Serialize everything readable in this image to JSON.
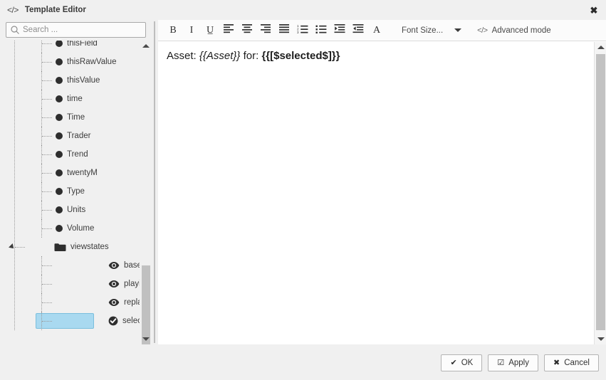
{
  "window": {
    "title": "Template Editor",
    "code_icon": "</>",
    "close_icon": "✖"
  },
  "sidebar": {
    "search": {
      "placeholder": "Search ...",
      "value": "",
      "icon": "search-icon"
    },
    "tree": [
      {
        "label": "thisField",
        "icon": "bullet-dot-icon",
        "level": 2,
        "selected": false
      },
      {
        "label": "thisRawValue",
        "icon": "bullet-dot-icon",
        "level": 2,
        "selected": false
      },
      {
        "label": "thisValue",
        "icon": "bullet-dot-icon",
        "level": 2,
        "selected": false
      },
      {
        "label": "time",
        "icon": "bullet-dot-icon",
        "level": 2,
        "selected": false
      },
      {
        "label": "Time",
        "icon": "bullet-dot-icon",
        "level": 2,
        "selected": false
      },
      {
        "label": "Trader",
        "icon": "bullet-dot-icon",
        "level": 2,
        "selected": false
      },
      {
        "label": "Trend",
        "icon": "bullet-dot-icon",
        "level": 2,
        "selected": false
      },
      {
        "label": "twentyM",
        "icon": "bullet-dot-icon",
        "level": 2,
        "selected": false
      },
      {
        "label": "Type",
        "icon": "bullet-dot-icon",
        "level": 2,
        "selected": false
      },
      {
        "label": "Units",
        "icon": "bullet-dot-icon",
        "level": 2,
        "selected": false
      },
      {
        "label": "Volume",
        "icon": "bullet-dot-icon",
        "level": 2,
        "selected": false
      },
      {
        "label": "viewstates",
        "icon": "folder-icon",
        "level": 1,
        "selected": false,
        "expanded": true
      },
      {
        "label": "basetime",
        "icon": "eye-icon",
        "level": 2,
        "selected": false
      },
      {
        "label": "playing",
        "icon": "eye-icon",
        "level": 2,
        "selected": false
      },
      {
        "label": "replayValue",
        "icon": "eye-icon",
        "level": 2,
        "selected": false
      },
      {
        "label": "selected",
        "icon": "check-circle-icon",
        "level": 2,
        "selected": true
      }
    ],
    "scrollbar": {
      "up_icon": "caret-up-icon",
      "down_icon": "caret-down-icon"
    }
  },
  "toolbar": {
    "buttons": [
      {
        "name": "bold-button",
        "glyph": "B",
        "serif": true
      },
      {
        "name": "italic-button",
        "glyph": "I",
        "serif": true
      },
      {
        "name": "underline-button",
        "glyph": "U̲",
        "serif": true
      },
      {
        "name": "align-left-button",
        "glyph": "",
        "serif": false
      },
      {
        "name": "align-center-button",
        "glyph": "",
        "serif": false
      },
      {
        "name": "align-right-button",
        "glyph": "",
        "serif": false
      },
      {
        "name": "align-justify-button",
        "glyph": "",
        "serif": false
      },
      {
        "name": "ordered-list-button",
        "glyph": "",
        "serif": false
      },
      {
        "name": "unordered-list-button",
        "glyph": "",
        "serif": false
      },
      {
        "name": "indent-button",
        "glyph": "",
        "serif": false
      },
      {
        "name": "outdent-button",
        "glyph": "",
        "serif": false
      },
      {
        "name": "font-color-button",
        "glyph": "A",
        "serif": true
      }
    ],
    "font_size": {
      "label": "Font Size...",
      "caret_icon": "chevron-down-icon"
    },
    "advanced": {
      "icon": "</>",
      "label": "Advanced mode"
    }
  },
  "editor": {
    "content": {
      "prefix": "Asset: ",
      "italic_token": "{{Asset}}",
      "middle": " for: ",
      "bold_token": "{{[$selected$]}}"
    },
    "scrollbar": {
      "up_icon": "caret-up-icon",
      "down_icon": "caret-down-icon"
    }
  },
  "footer": {
    "buttons": [
      {
        "name": "ok-button",
        "icon": "✔",
        "label": "OK"
      },
      {
        "name": "apply-button",
        "icon": "☑",
        "label": "Apply"
      },
      {
        "name": "cancel-button",
        "icon": "✖",
        "label": "Cancel"
      }
    ]
  },
  "colors": {
    "window_bg": "#f0f0f0",
    "editor_bg": "#ffffff",
    "selection_bg": "#a9d9f0",
    "selection_border": "#7bbfdd",
    "scroll_thumb": "#c0c0c0",
    "text": "#3c3c3c"
  }
}
